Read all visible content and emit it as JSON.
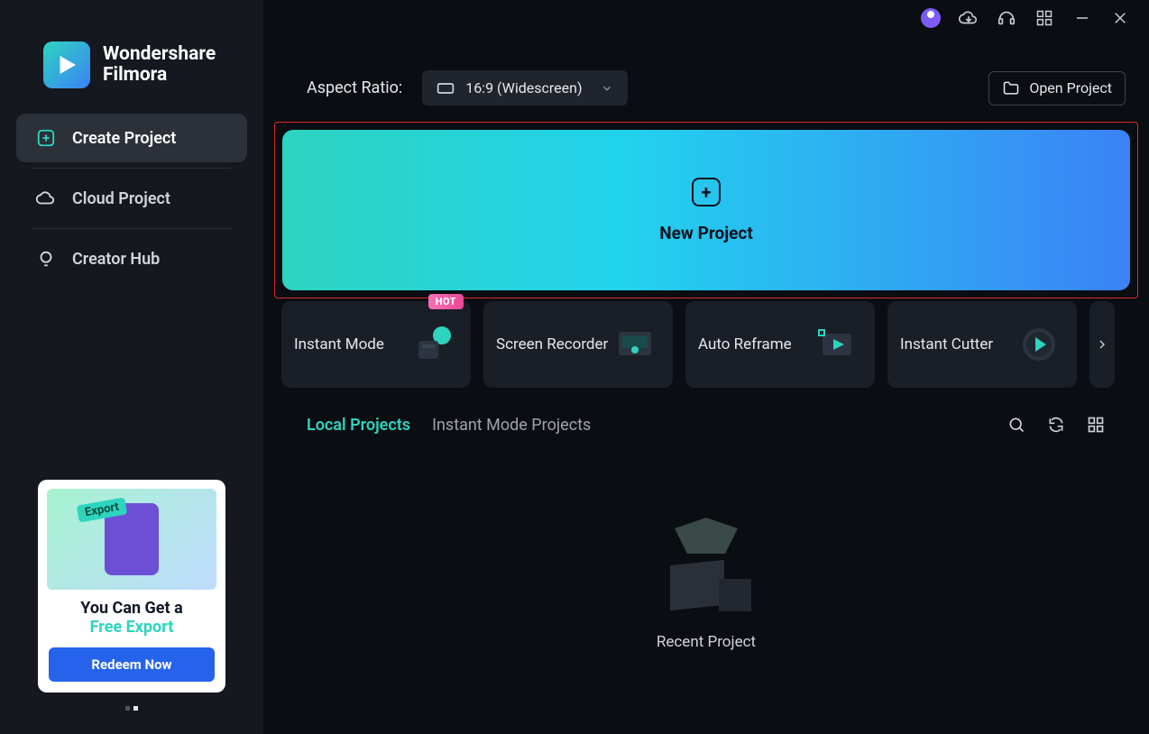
{
  "brand": {
    "line1": "Wondershare",
    "line2": "Filmora"
  },
  "nav": {
    "create": "Create Project",
    "cloud": "Cloud Project",
    "hub": "Creator Hub"
  },
  "promo": {
    "title": "You Can Get a",
    "subtitle": "Free Export",
    "button": "Redeem Now"
  },
  "toolbar": {
    "aspect_label": "Aspect Ratio:",
    "aspect_value": "16:9 (Widescreen)",
    "open_project": "Open Project"
  },
  "new_project": {
    "label": "New Project"
  },
  "tools": [
    {
      "label": "Instant Mode",
      "badge": "HOT"
    },
    {
      "label": "Screen Recorder"
    },
    {
      "label": "Auto Reframe"
    },
    {
      "label": "Instant Cutter"
    }
  ],
  "projects": {
    "tabs": {
      "local": "Local Projects",
      "instant": "Instant Mode Projects"
    },
    "empty_label": "Recent Project"
  }
}
